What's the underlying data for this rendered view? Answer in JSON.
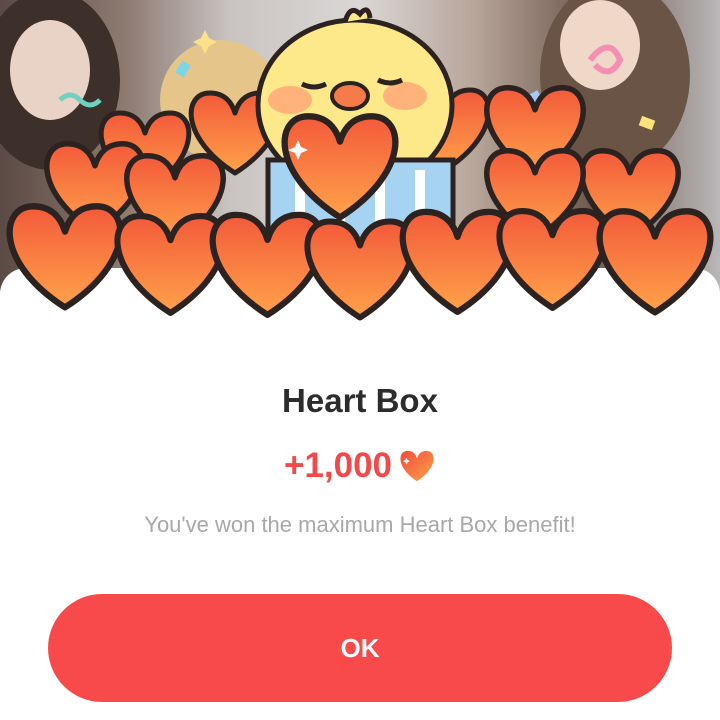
{
  "dialog": {
    "title": "Heart Box",
    "reward_amount": "+1,000",
    "reward_icon": "heart-icon",
    "message": "You've won the maximum Heart Box benefit!",
    "ok_label": "OK"
  },
  "colors": {
    "accent": "#f84a4a",
    "reward_text": "#f04a4a",
    "title_text": "#2c2c2c",
    "message_text": "#a8a8a8",
    "heart_fill": "#ff6b45",
    "chick_fill": "#fde88a"
  }
}
